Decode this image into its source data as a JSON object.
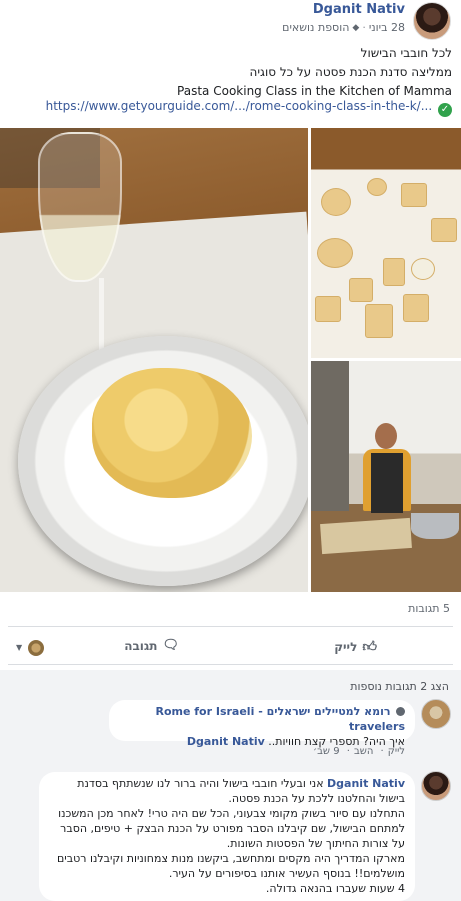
{
  "post": {
    "author": "Dganit Nativ",
    "date": "28 ביוני",
    "dot": "·",
    "tag_label": "הוספת נושאים",
    "lines": [
      "לכל חובבי הבישול",
      "ממליצה סדנת הכנת פסטה על כל סוגיה"
    ],
    "english_title": "Pasta Cooking Class in the Kitchen of Mamma",
    "link": "https://www.getyourguide.com/.../rome-cooking-class-in-the-k/..."
  },
  "reactions": {
    "count_label": "5 תגובות"
  },
  "actions": {
    "like": "לייק",
    "comment": "תגובה"
  },
  "comments": {
    "more_replies": "הצג 2 תגובות נוספות",
    "items": [
      {
        "author": "רומא למטיילים ישראלים - Rome for Israeli travelers",
        "reply_to": "Dganit Nativ",
        "text": "איך היה? תספרי קצת חוויות..",
        "like": "לייק",
        "reply": "השב",
        "time": "9 שב׳"
      },
      {
        "author": "Dganit Nativ",
        "lines": [
          "אני ובעלי חובבי בישול והיה ברור לנו שנשתתף בסדנת בישול והחלטנו ללכת על הכנת פסטה.",
          "התחלנו עם סיור בשוק מקומי צבעוני, הכל שם היה טרי! לאחר מכן המשכנו למתחם הבישול, שם קיבלנו הסבר מפורט על הכנת הבצק + טיפים, הסבר על צורות החיתוך של הפסטות השונות.",
          "מארקו המדריך היה מקסים ומתחשב, ביקשנו מנות צמחוניות וקיבלנו רטבים מושלמים!! בנוסף העשיר אותנו בסיפורים על העיר.",
          "4 שעות שעברו בהנאה גדולה."
        ]
      }
    ]
  },
  "colors": {
    "link": "#385898",
    "secondary_text": "#606770",
    "verified_green": "#31a24c"
  }
}
